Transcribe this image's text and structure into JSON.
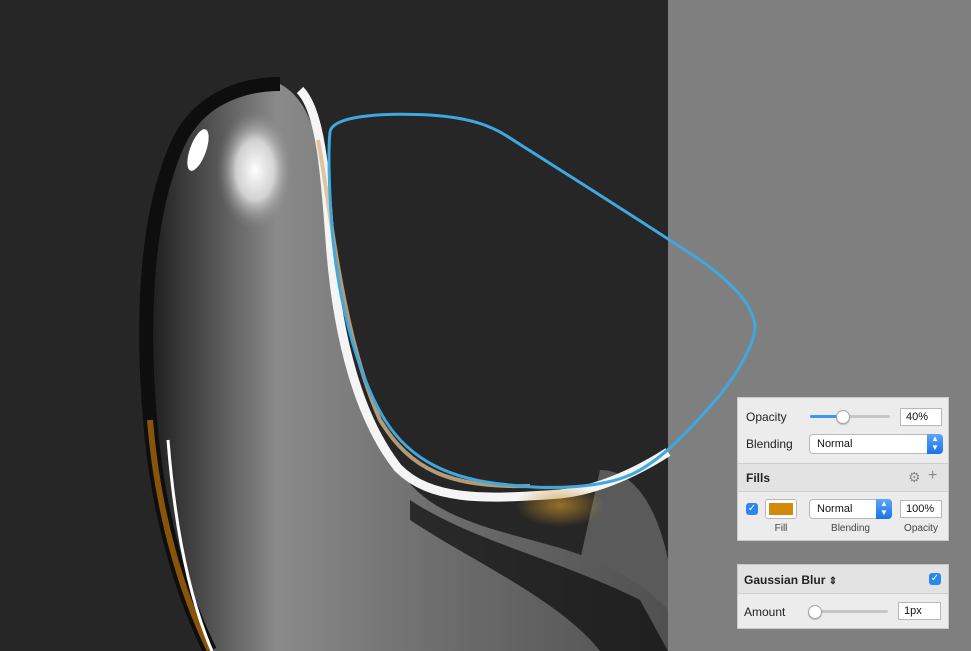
{
  "style_panel": {
    "opacity_label": "Opacity",
    "opacity_value": "40%",
    "opacity_fraction": 0.4,
    "blending_label": "Blending",
    "blending_value": "Normal",
    "fills_header": "Fills",
    "gear_icon": "gear-icon",
    "add_icon": "plus-icon",
    "fill": {
      "enabled": true,
      "color": "#d2890c",
      "swatch_caption": "Fill",
      "blending_value": "Normal",
      "blending_caption": "Blending",
      "opacity_value": "100%",
      "opacity_caption": "Opacity"
    }
  },
  "blur_panel": {
    "title": "Gaussian Blur",
    "enabled": true,
    "amount_label": "Amount",
    "amount_value": "1px",
    "amount_fraction": 0.05
  },
  "colors": {
    "canvas_bg": "#262626",
    "right_area": "#7f7f7f",
    "selection_outline": "#3ea8e0",
    "accent": "#2b86f0"
  }
}
